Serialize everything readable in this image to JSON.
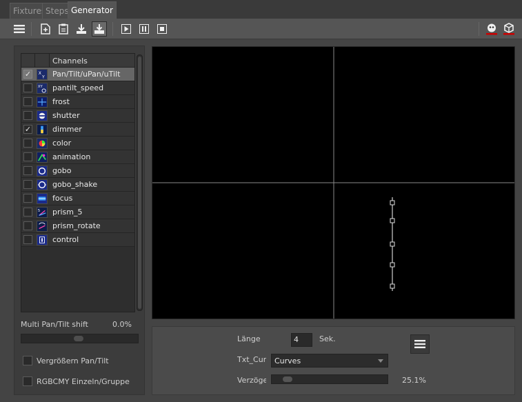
{
  "tabs": [
    {
      "label": "Fixtures",
      "active": false
    },
    {
      "label": "Steps",
      "active": false
    },
    {
      "label": "Generator",
      "active": true
    }
  ],
  "toolbar": {
    "icons": [
      "menu-icon",
      "new-page-icon",
      "clipboard-icon",
      "download-icon",
      "import-icon",
      "play-icon",
      "pause-icon",
      "stop-icon",
      "face-red-icon",
      "cube-red-icon"
    ]
  },
  "channels": {
    "header": "Channels",
    "items": [
      {
        "label": "Pan/Tilt/uPan/uTilt",
        "checked": true,
        "selected": true,
        "icon": "xy-icon"
      },
      {
        "label": "pantilt_speed",
        "checked": false,
        "selected": false,
        "icon": "xy-speed-icon"
      },
      {
        "label": "frost",
        "checked": false,
        "selected": false,
        "icon": "frost-icon"
      },
      {
        "label": "shutter",
        "checked": false,
        "selected": false,
        "icon": "shutter-icon"
      },
      {
        "label": "dimmer",
        "checked": true,
        "selected": false,
        "icon": "dimmer-icon"
      },
      {
        "label": "color",
        "checked": false,
        "selected": false,
        "icon": "color-icon"
      },
      {
        "label": "animation",
        "checked": false,
        "selected": false,
        "icon": "animation-icon"
      },
      {
        "label": "gobo",
        "checked": false,
        "selected": false,
        "icon": "gobo-icon"
      },
      {
        "label": "gobo_shake",
        "checked": false,
        "selected": false,
        "icon": "gobo-shake-icon"
      },
      {
        "label": "focus",
        "checked": false,
        "selected": false,
        "icon": "focus-icon"
      },
      {
        "label": "prism_5",
        "checked": false,
        "selected": false,
        "icon": "prism-icon"
      },
      {
        "label": "prism_rotate",
        "checked": false,
        "selected": false,
        "icon": "prism-rotate-icon"
      },
      {
        "label": "control",
        "checked": false,
        "selected": false,
        "icon": "control-icon"
      }
    ]
  },
  "left": {
    "multi_label": "Multi Pan/Tilt shift",
    "multi_value": "0.0%",
    "opt1_label": "Vergrößern Pan/Tilt",
    "opt2_label": "RGBCMY Einzeln/Gruppe"
  },
  "bottom": {
    "laenge_label": "Länge",
    "laenge_value": "4",
    "laenge_unit": "Sek.",
    "txt_label": "Txt_Curve",
    "txt_value": "Curves",
    "verz_label": "Verzögerung",
    "verz_value": "25.1%"
  },
  "colors": {
    "accent_red": "#cc0000",
    "selection": "#666666"
  }
}
